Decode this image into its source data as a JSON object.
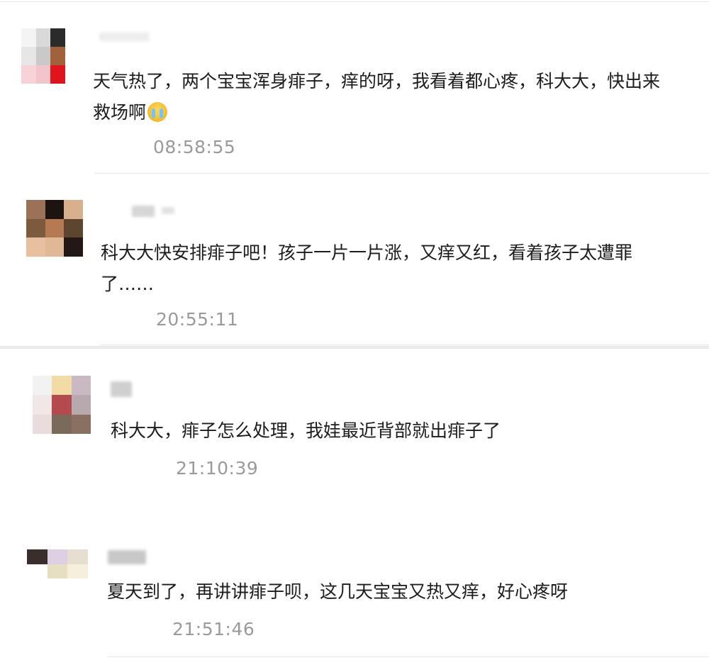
{
  "comments": [
    {
      "text_line1": "天气热了，两个宝宝浑身痱子，痒的呀，我看着都心疼，科大大，快出来",
      "text_line2": "救场啊",
      "emoji": "crying-face-icon",
      "time": "08:58:55"
    },
    {
      "text_line1": "科大大快安排痱子吧！孩子一片一片涨，又痒又红，看着孩子太遭罪",
      "text_line2": "了……",
      "time": "20:55:11"
    },
    {
      "text_line1": "科大大，痱子怎么处理，我娃最近背部就出痱子了",
      "time": "21:10:39"
    },
    {
      "text_line1": "夏天到了，再讲讲痱子呗，这几天宝宝又热又痒，好心疼呀",
      "time": "21:51:46"
    }
  ],
  "colors": {
    "time_gray": "#9a9a9a",
    "text": "#1c1c1c",
    "divider": "#e8e8e8"
  }
}
